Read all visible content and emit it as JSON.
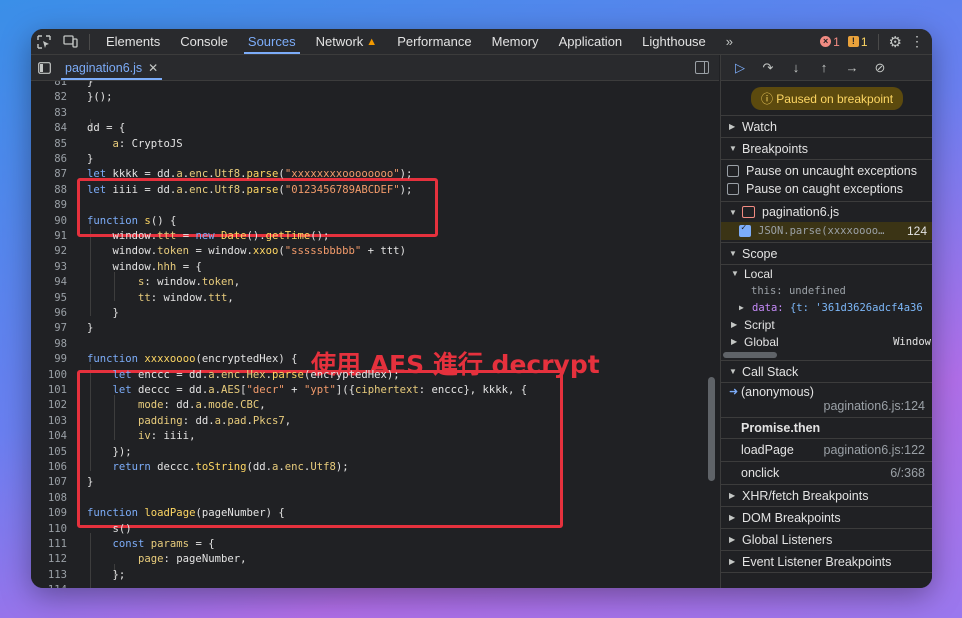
{
  "topbar": {
    "tabs": [
      "Elements",
      "Console",
      "Sources",
      "Network",
      "Performance",
      "Memory",
      "Application",
      "Lighthouse"
    ],
    "active_tab": "Sources",
    "more": "»",
    "error_count": "1",
    "warning_count": "1"
  },
  "editor": {
    "file_tab": "pagination6.js",
    "annotation": "使用 AES 進行 decrypt",
    "lines": [
      {
        "n": "81",
        "html": "}"
      },
      {
        "n": "82",
        "html": "}();"
      },
      {
        "n": "83",
        "html": ""
      },
      {
        "n": "84",
        "html": "dd = {"
      },
      {
        "n": "85",
        "html": "    <span class=\"prop\">a</span>: CryptoJS"
      },
      {
        "n": "86",
        "html": "}"
      },
      {
        "n": "87",
        "html": "<span class=\"kw\">let</span> kkkk = dd.<span class=\"prop\">a</span>.<span class=\"prop\">enc</span>.<span class=\"prop\">Utf8</span>.<span class=\"fn\">parse</span>(<span class=\"str\">\"xxxxxxxxoooooooo\"</span>);"
      },
      {
        "n": "88",
        "html": "<span class=\"kw\">let</span> iiii = dd.<span class=\"prop\">a</span>.<span class=\"prop\">enc</span>.<span class=\"prop\">Utf8</span>.<span class=\"fn\">parse</span>(<span class=\"str\">\"0123456789ABCDEF\"</span>);"
      },
      {
        "n": "89",
        "html": ""
      },
      {
        "n": "90",
        "html": "<span class=\"kw\">function</span> <span class=\"fn\">s</span>() {"
      },
      {
        "n": "91",
        "html": "    window.<span class=\"prop\">ttt</span> = <span class=\"kw\">new</span> <span class=\"fn\">Date</span>().<span class=\"fn\">getTime</span>();"
      },
      {
        "n": "92",
        "html": "    window.<span class=\"prop\">token</span> = window.<span class=\"fn\">xxoo</span>(<span class=\"str\">\"sssssbbbbb\"</span> + ttt)"
      },
      {
        "n": "93",
        "html": "    window.<span class=\"prop\">hhh</span> = {"
      },
      {
        "n": "94",
        "html": "        <span class=\"prop\">s</span>: window.<span class=\"prop\">token</span>,"
      },
      {
        "n": "95",
        "html": "        <span class=\"prop\">tt</span>: window.<span class=\"prop\">ttt</span>,"
      },
      {
        "n": "96",
        "html": "    }"
      },
      {
        "n": "97",
        "html": "}"
      },
      {
        "n": "98",
        "html": ""
      },
      {
        "n": "99",
        "html": "<span class=\"kw\">function</span> <span class=\"fn\">xxxxoooo</span>(encryptedHex) {"
      },
      {
        "n": "100",
        "html": "    <span class=\"kw\">let</span> enccc = dd.<span class=\"prop\">a</span>.<span class=\"prop\">enc</span>.<span class=\"prop\">Hex</span>.<span class=\"fn\">parse</span>(encryptedHex);"
      },
      {
        "n": "101",
        "html": "    <span class=\"kw\">let</span> deccc = dd.<span class=\"prop\">a</span>.<span class=\"prop\">AES</span>[<span class=\"str\">\"decr\"</span> + <span class=\"str\">\"ypt\"</span>]({<span class=\"prop\">ciphertext</span>: enccc}, kkkk, {"
      },
      {
        "n": "102",
        "html": "        <span class=\"prop\">mode</span>: dd.<span class=\"prop\">a</span>.<span class=\"prop\">mode</span>.<span class=\"prop\">CBC</span>,"
      },
      {
        "n": "103",
        "html": "        <span class=\"prop\">padding</span>: dd.<span class=\"prop\">a</span>.<span class=\"prop\">pad</span>.<span class=\"prop\">Pkcs7</span>,"
      },
      {
        "n": "104",
        "html": "        <span class=\"prop\">iv</span>: iiii,"
      },
      {
        "n": "105",
        "html": "    });"
      },
      {
        "n": "106",
        "html": "    <span class=\"kw\">return</span> deccc.<span class=\"fn\">toString</span>(dd.<span class=\"prop\">a</span>.<span class=\"prop\">enc</span>.<span class=\"prop\">Utf8</span>);"
      },
      {
        "n": "107",
        "html": "}"
      },
      {
        "n": "108",
        "html": ""
      },
      {
        "n": "109",
        "html": "<span class=\"kw\">function</span> <span class=\"fn\">loadPage</span>(pageNumber) {"
      },
      {
        "n": "110",
        "html": "    s()"
      },
      {
        "n": "111",
        "html": "    <span class=\"kw\">const</span> <span class=\"prop\">params</span> = {"
      },
      {
        "n": "112",
        "html": "        <span class=\"prop\">page</span>: pageNumber,"
      },
      {
        "n": "113",
        "html": "    };"
      },
      {
        "n": "114",
        "html": ""
      }
    ]
  },
  "debugger": {
    "paused_label": "Paused on breakpoint",
    "watch": "Watch",
    "breakpoints": "Breakpoints",
    "pause_uncaught": "Pause on uncaught exceptions",
    "pause_caught": "Pause on caught exceptions",
    "bp_file": "pagination6.js",
    "bp_code": "JSON.parse(xxxxoooo…",
    "bp_line": "124",
    "scope": "Scope",
    "local": "Local",
    "this_key": "this:",
    "this_val": "undefined",
    "data_key": "data:",
    "data_val": "{t: '361d3626adcf4a36",
    "script": "Script",
    "global": "Global",
    "global_val": "Window",
    "call_stack": "Call Stack",
    "frames": [
      {
        "name": "(anonymous)",
        "loc": "pagination6.js:124"
      },
      {
        "name": "Promise.then",
        "loc": ""
      },
      {
        "name": "loadPage",
        "loc": "pagination6.js:122"
      },
      {
        "name": "onclick",
        "loc": "6/:368"
      }
    ],
    "xhr": "XHR/fetch Breakpoints",
    "dom": "DOM Breakpoints",
    "global_listeners": "Global Listeners",
    "event_listeners": "Event Listener Breakpoints"
  },
  "colors": {
    "accent": "#7cacf8",
    "annotation_red": "#e5313d",
    "paused_yellow": "#fdd663"
  }
}
